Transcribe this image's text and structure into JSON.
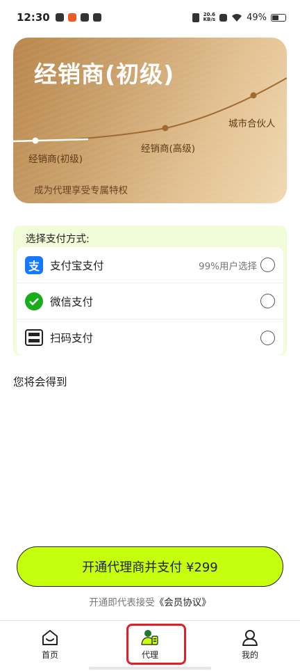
{
  "status_bar": {
    "time": "12:30",
    "net_speed_value": "20.6",
    "net_speed_unit": "KB/s",
    "battery": "49%"
  },
  "tier_card": {
    "title": "经销商(初级)",
    "levels": [
      "经销商(初级)",
      "经销商(高级)",
      "城市合伙人"
    ],
    "subtitle": "成为代理享受专属特权"
  },
  "payment": {
    "header": "选择支付方式:",
    "options": [
      {
        "name": "支付宝支付",
        "note": "99%用户选择",
        "icon": "alipay-icon"
      },
      {
        "name": "微信支付",
        "note": "",
        "icon": "wechat-icon"
      },
      {
        "name": "扫码支付",
        "note": "",
        "icon": "scan-icon"
      }
    ]
  },
  "benefits_title": "您将会得到",
  "pay_button": "开通代理商并支付 ¥299",
  "agreement": {
    "prefix": "开通即代表接受",
    "link": "《会员协议》"
  },
  "tabs": [
    {
      "label": "首页",
      "icon": "home-icon"
    },
    {
      "label": "代理",
      "icon": "agent-icon"
    },
    {
      "label": "我的",
      "icon": "user-icon"
    }
  ],
  "colors": {
    "accent": "#c5ff0d",
    "card_gold": "#c99c63",
    "highlight": "#e01f26",
    "alipay": "#1677ff",
    "wechat": "#1aad19"
  }
}
